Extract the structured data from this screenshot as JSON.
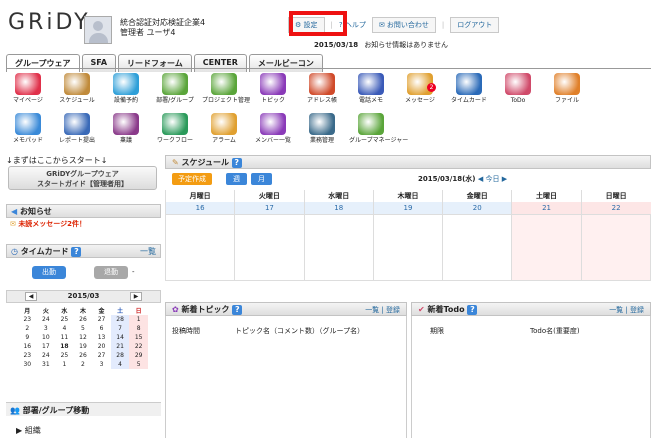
{
  "header": {
    "logo": "GRiDY",
    "org_name": "統合認証対応検証企業4",
    "user_name": "管理者 ユーザ4",
    "avatar_text": "NO IMAGE",
    "settings_label": "設定",
    "help_label": "ヘルプ",
    "contact_label": "お問い合わせ",
    "logout_label": "ログアウト",
    "date": "2015/03/18",
    "info_msg": "お知らせ情報はありません"
  },
  "tabs": [
    "グループウェア",
    "SFA",
    "リードフォーム",
    "CENTER",
    "メールビーコン"
  ],
  "icons_row1": [
    {
      "label": "マイページ",
      "icon": "house-icon",
      "color": "#e0304a"
    },
    {
      "label": "スケジュール",
      "icon": "pen-icon",
      "color": "#c08a3a"
    },
    {
      "label": "設備予約",
      "icon": "people-icon",
      "color": "#2e9fd8"
    },
    {
      "label": "部署/グループ",
      "icon": "group-icon",
      "color": "#5aa53a"
    },
    {
      "label": "プロジェクト管理",
      "icon": "project-icon",
      "color": "#5aa53a"
    },
    {
      "label": "トピック",
      "icon": "topic-icon",
      "color": "#8a3ab8"
    },
    {
      "label": "アドレス帳",
      "icon": "address-icon",
      "color": "#d04a2a"
    },
    {
      "label": "電話メモ",
      "icon": "phone-icon",
      "color": "#3a5ab8"
    },
    {
      "label": "メッセージ",
      "icon": "message-icon",
      "color": "#e0a030",
      "badge": "2"
    },
    {
      "label": "タイムカード",
      "icon": "clock-icon",
      "color": "#2a6ab8"
    },
    {
      "label": "ToDo",
      "icon": "todo-icon",
      "color": "#d04a6a"
    },
    {
      "label": "ファイル",
      "icon": "folder-icon",
      "color": "#e0802a"
    }
  ],
  "icons_row2": [
    {
      "label": "メモパッド",
      "icon": "memo-icon",
      "color": "#3a8ad8"
    },
    {
      "label": "レポート提出",
      "icon": "report-icon",
      "color": "#3a6ab8"
    },
    {
      "label": "稟議",
      "icon": "approval-icon",
      "color": "#8a3a8a"
    },
    {
      "label": "ワークフロー",
      "icon": "workflow-icon",
      "color": "#2a9a5a"
    },
    {
      "label": "アラーム",
      "icon": "alarm-icon",
      "color": "#e0a030"
    },
    {
      "label": "メンバー一覧",
      "icon": "members-icon",
      "color": "#8a3ab8"
    },
    {
      "label": "業務管理",
      "icon": "business-icon",
      "color": "#3a6a8a"
    },
    {
      "label": "グループマネージャー",
      "icon": "group-manager-icon",
      "color": "#5aa53a"
    }
  ],
  "left": {
    "start_text": "↓まずはここからスタート↓",
    "guide_line1": "GRiDYグループウェア",
    "guide_line2": "スタートガイド【管理者用】",
    "notice_title": "お知らせ",
    "notice_item": "未読メッセージ2件！",
    "timecard_title": "タイムカード",
    "timecard_more": "一覧",
    "clock_in": "出勤",
    "clock_out": "退勤",
    "clock_out_value": "-",
    "cal_month": "2015/03",
    "cal_head": [
      "月",
      "火",
      "水",
      "木",
      "金",
      "土",
      "日"
    ],
    "cal_rows": [
      [
        "23",
        "24",
        "25",
        "26",
        "27",
        "28",
        "1"
      ],
      [
        "2",
        "3",
        "4",
        "5",
        "6",
        "7",
        "8"
      ],
      [
        "9",
        "10",
        "11",
        "12",
        "13",
        "14",
        "15"
      ],
      [
        "16",
        "17",
        "18",
        "19",
        "20",
        "21",
        "22"
      ],
      [
        "23",
        "24",
        "25",
        "26",
        "27",
        "28",
        "29"
      ],
      [
        "30",
        "31",
        "1",
        "2",
        "3",
        "4",
        "5"
      ]
    ],
    "dept_title": "部署/グループ移動",
    "tree_item": "組織"
  },
  "schedule": {
    "title": "スケジュール",
    "btn_new": "予定作成",
    "btn_week": "週",
    "btn_month": "月",
    "date_text": "2015/03/18(水)",
    "today": "◀ 今日 ▶",
    "days": [
      "月曜日",
      "火曜日",
      "水曜日",
      "木曜日",
      "金曜日",
      "土曜日",
      "日曜日"
    ],
    "dates": [
      "16",
      "17",
      "18",
      "19",
      "20",
      "21",
      "22"
    ]
  },
  "topic": {
    "title": "新着トピック",
    "links": "一覧 | 登録",
    "col1": "投稿時間",
    "col2": "トピック名（コメント数）（グループ名）"
  },
  "todo": {
    "title": "新着Todo",
    "links": "一覧 | 登録",
    "col1": "期限",
    "col2": "Todo名(重要度)"
  }
}
